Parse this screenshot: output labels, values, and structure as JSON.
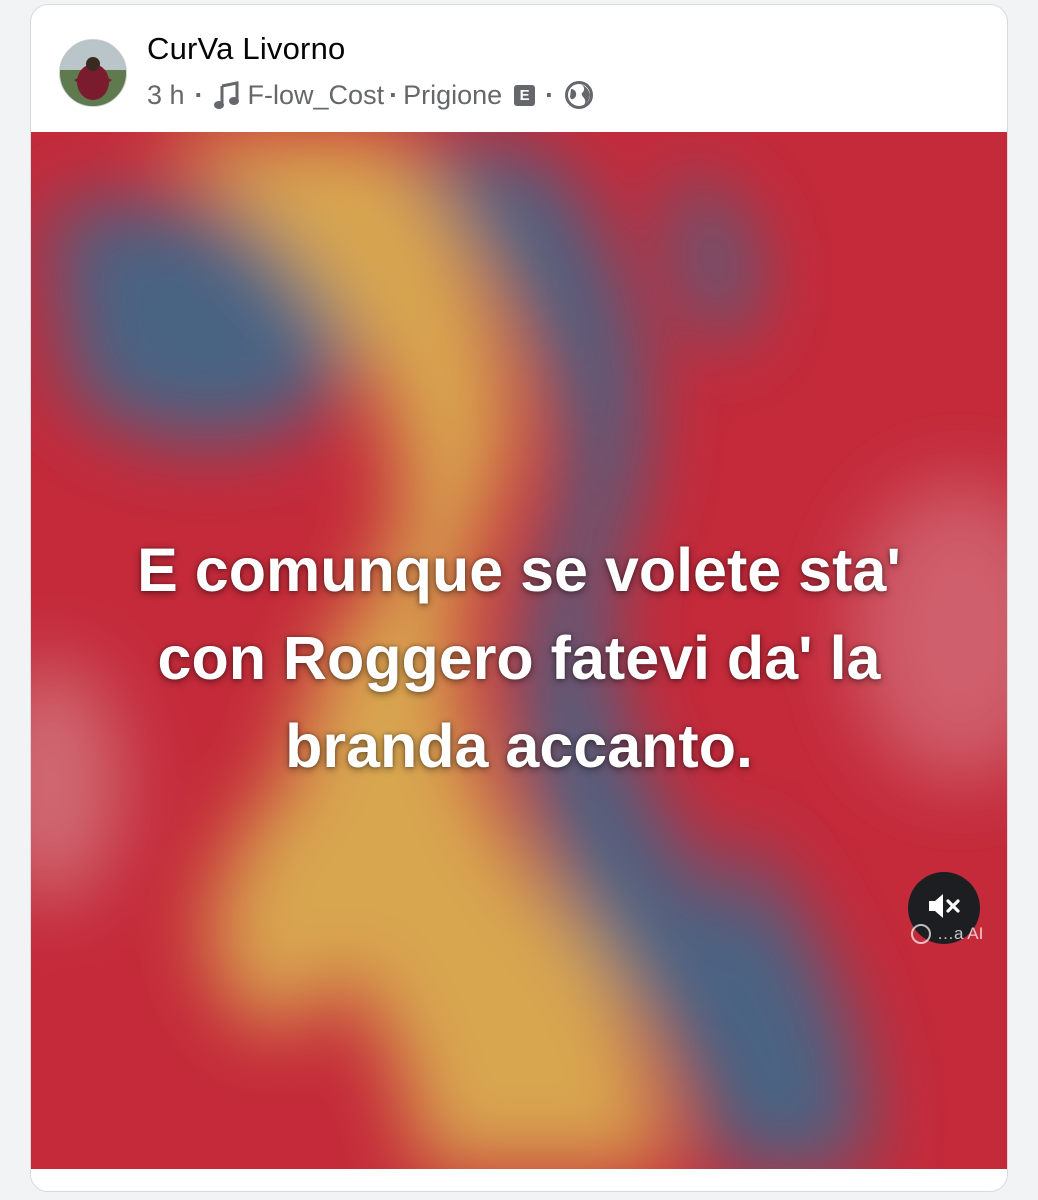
{
  "post": {
    "author": "CurVa Livorno",
    "time": "3 h",
    "separator": "·",
    "song_artist": "F-low_Cost",
    "song_title": "Prigione",
    "explicit_badge": "E",
    "caption": "E comunque se volete sta' con Roggero fatevi da' la branda accanto.",
    "ai_label": "…a AI"
  },
  "icons": {
    "avatar": "avatar",
    "music": "music-note-icon",
    "explicit": "explicit-icon",
    "audience": "globe-icon",
    "mute": "mute-icon",
    "ai": "ai-icon"
  },
  "colors": {
    "red": "#c42a3a",
    "blue": "#4a6483",
    "yellow": "#d8a650",
    "text_secondary": "#65676b",
    "mute_button": "#1c1e21"
  }
}
